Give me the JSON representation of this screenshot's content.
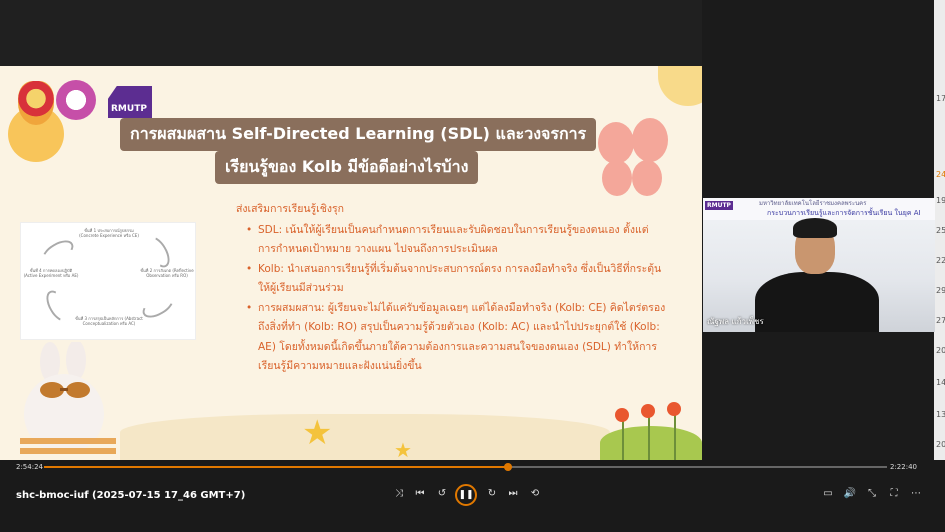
{
  "slide": {
    "logo_text": "RMUTP",
    "title_line1": "การผสมผสาน Self-Directed Learning (SDL) และวงจรการ",
    "title_line2": "เรียนรู้ของ Kolb มีข้อดีอย่างไรบ้าง",
    "intro_heading": "ส่งเสริมการเรียนรู้เชิงรุก",
    "bullets": [
      "SDL: เน้นให้ผู้เรียนเป็นคนกำหนดการเรียนและรับผิดชอบในการเรียนรู้ของตนเอง ตั้งแต่การกำหนดเป้าหมาย วางแผน ไปจนถึงการประเมินผล",
      "Kolb: นำเสนอการเรียนรู้ที่เริ่มต้นจากประสบการณ์ตรง การลงมือทำจริง ซึ่งเป็นวิธีที่กระตุ้นให้ผู้เรียนมีส่วนร่วม",
      "การผสมผสาน: ผู้เรียนจะไม่ได้แค่รับข้อมูลเฉยๆ แต่ได้ลงมือทำจริง (Kolb: CE) คิดไตร่ตรองถึงสิ่งที่ทำ (Kolb: RO) สรุปเป็นความรู้ด้วยตัวเอง (Kolb: AC) และนำไปประยุกต์ใช้ (Kolb: AE) โดยทั้งหมดนี้เกิดขึ้นภายใต้ความต้องการและความสนใจของตนเอง (SDL) ทำให้การเรียนรู้มีความหมายและฝังแน่นยิ่งขึ้น"
    ],
    "diagram": {
      "stage1": "ขั้นที่ 1 ประสบการณ์รูปธรรม (Concrete Experience หรือ CE)",
      "stage2": "ขั้นที่ 2 การสังเกต (Reflective Observation หรือ RO)",
      "stage3": "ขั้นที่ 3 การสรุปเป็นหลักการ (Abstract Conceptualization หรือ AC)",
      "stage4": "ขั้นที่ 4 การทดลองปฏิบัติ (Active Experiment หรือ AE)"
    }
  },
  "webcam": {
    "logo_text": "RMUTP",
    "header": "มหาวิทยาลัยเทคโนโลยีราชมงคลพระนคร",
    "subheader": "กระบวนการเรียนรู้และการจัดการชั้นเรียน ในยุค AI",
    "presenter_name": "ณัฐพล แก้วเพ็ชร"
  },
  "right_strip": {
    "numbers": [
      "17",
      "24",
      "19",
      "25",
      "22",
      "29",
      "27",
      "20",
      "14",
      "13",
      "20"
    ]
  },
  "player": {
    "video_title": "shc-bmoc-iuf (2025-07-15 17_46 GMT+7)",
    "time_current": "2:54:24",
    "time_total": "2:22:40",
    "progress_fraction": 0.55,
    "accent_color": "#e07800",
    "icons": [
      "shuffle-icon",
      "previous-icon",
      "rewind-10-icon",
      "pause-icon",
      "forward-30-icon",
      "next-icon",
      "repeat-off-icon",
      "miniplayer-icon",
      "volume-icon",
      "cast-icon",
      "fullscreen-icon",
      "more-icon"
    ]
  }
}
